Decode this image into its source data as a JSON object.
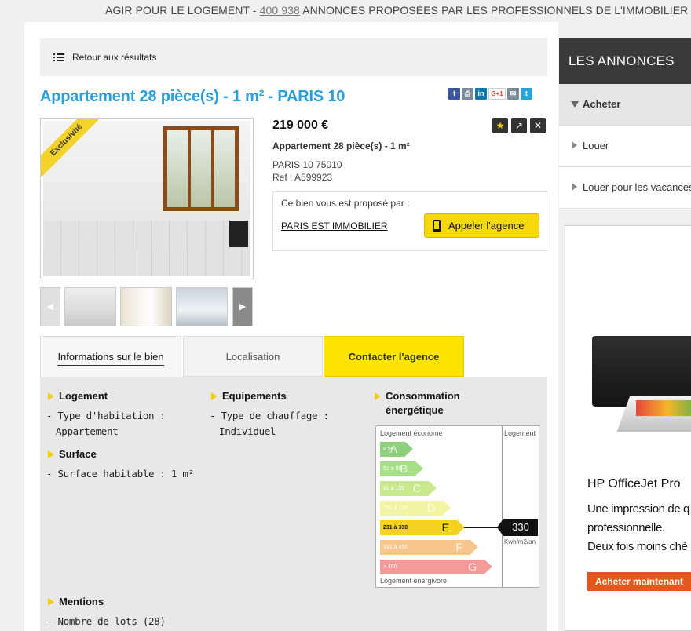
{
  "banner": {
    "prefix": "AGIR POUR LE LOGEMENT - ",
    "count": "400 938",
    "suffix": " ANNONCES PROPOSÉES PAR LES PROFESSIONNELS DE L'IMMOBILIER"
  },
  "back": {
    "label": "Retour aux résultats"
  },
  "listing": {
    "title": "Appartement 28 pièce(s) - 1 m² - PARIS 10",
    "price": "219 000 €",
    "subtitle": "Appartement 28 pièce(s) - 1 m²",
    "city": "PARIS 10 75010",
    "ref": "Ref : A599923",
    "badge": "Exclusivité"
  },
  "share": [
    {
      "icon": "facebook-icon",
      "glyph": "f",
      "color": "#3b5998"
    },
    {
      "icon": "print-icon",
      "glyph": "⎙",
      "color": "#7a8a99"
    },
    {
      "icon": "linkedin-icon",
      "glyph": "in",
      "color": "#0e76a8"
    },
    {
      "icon": "google-plus-icon",
      "glyph": "G+1",
      "color": "#ffffff"
    },
    {
      "icon": "email-icon",
      "glyph": "✉",
      "color": "#7a8a99"
    },
    {
      "icon": "twitter-icon",
      "glyph": "t",
      "color": "#2aa3d8"
    }
  ],
  "agency": {
    "intro": "Ce bien vous est proposé par :",
    "name": "PARIS EST IMMOBILIER",
    "call": "Appeler l'agence"
  },
  "tabs": {
    "info": "Informations sur le bien",
    "location": "Localisation",
    "contact": "Contacter l'agence"
  },
  "details": {
    "logement_h": "Logement",
    "logement_1": "- Type d'habitation :",
    "logement_2": "Appartement",
    "surface_h": "Surface",
    "surface_1": "- Surface habitable : 1 m²",
    "equip_h": "Equipements",
    "equip_1": "- Type de chauffage :",
    "equip_2": "Individuel",
    "conso_h1": "Consommation",
    "conso_h2": "énergétique",
    "mentions_h": "Mentions",
    "mentions_1": "- Nombre de lots (28)"
  },
  "energy": {
    "top": "Logement économe",
    "right": "Logement",
    "bottom": "Logement énergivore",
    "value": "330",
    "unit": "Kwh/m2/an",
    "active_class": "E",
    "classes": [
      {
        "range": "≤ 50",
        "letter": "A",
        "color": "#8fd07d"
      },
      {
        "range": "51 à 90",
        "letter": "B",
        "color": "#a6df86"
      },
      {
        "range": "91 à 150",
        "letter": "C",
        "color": "#c9e98c"
      },
      {
        "range": "151 à 230",
        "letter": "D",
        "color": "#f2f4a1"
      },
      {
        "range": "231 à 330",
        "letter": "E",
        "color": "#f5d21f"
      },
      {
        "range": "331 à 450",
        "letter": "F",
        "color": "#f6c68d"
      },
      {
        "range": "> 450",
        "letter": "G",
        "color": "#f39a9a"
      }
    ]
  },
  "sidebar": {
    "title": "LES ANNONCES",
    "items": [
      "Acheter",
      "Louer",
      "Louer pour les vacances"
    ]
  },
  "ad": {
    "title": "HP OfficeJet Pro",
    "line1": "Une impression de q",
    "line2": "professionnelle.",
    "line3": "Deux fois moins chè",
    "button": "Acheter maintenant"
  }
}
